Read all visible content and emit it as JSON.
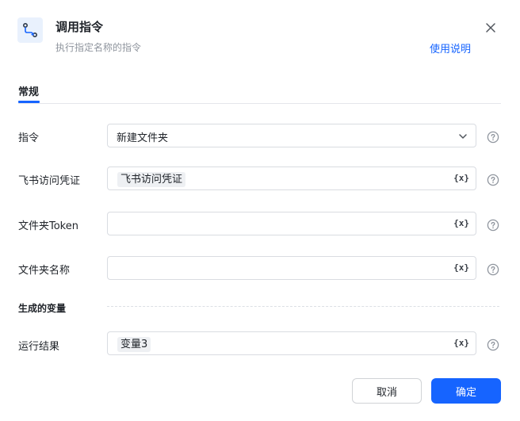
{
  "dialog": {
    "icon": "connector-icon",
    "title": "调用指令",
    "subtitle": "执行指定名称的指令",
    "help_link": "使用说明"
  },
  "tabs": [
    {
      "label": "常规",
      "active": true
    }
  ],
  "form": {
    "command": {
      "label": "指令",
      "value": "新建文件夹"
    },
    "credential": {
      "label": "飞书访问凭证",
      "chip": "飞书访问凭证",
      "var_symbol": "{x}"
    },
    "folder_token": {
      "label": "文件夹Token",
      "value": "",
      "var_symbol": "{x}"
    },
    "folder_name": {
      "label": "文件夹名称",
      "value": "",
      "var_symbol": "{x}"
    },
    "output_section": "生成的变量",
    "result": {
      "label": "运行结果",
      "chip": "变量3",
      "var_symbol": "{x}"
    }
  },
  "buttons": {
    "cancel": "取消",
    "ok": "确定"
  },
  "colors": {
    "accent": "#1664ff",
    "icon_bg": "#e9f1fd",
    "chip_bg": "#eef0f3"
  }
}
